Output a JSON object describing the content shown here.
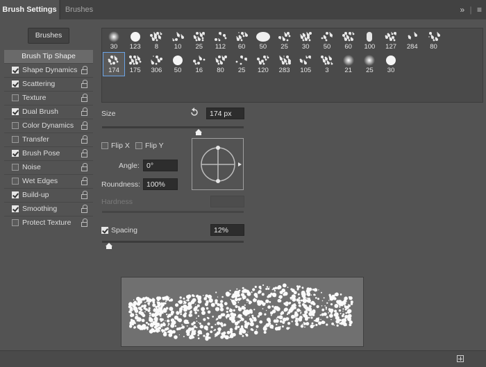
{
  "tabs": {
    "active": "Brush Settings",
    "inactive": "Brushes",
    "expand_icon": "double-chevron-right-icon",
    "menu_icon": "hamburger-menu-icon"
  },
  "brushes_button": "Brushes",
  "sidebar": {
    "items": [
      {
        "label": "Brush Tip Shape",
        "checkbox": null,
        "lock": false
      },
      {
        "label": "Shape Dynamics",
        "checkbox": true,
        "lock": true
      },
      {
        "label": "Scattering",
        "checkbox": true,
        "lock": true
      },
      {
        "label": "Texture",
        "checkbox": false,
        "lock": true
      },
      {
        "label": "Dual Brush",
        "checkbox": true,
        "lock": true
      },
      {
        "label": "Color Dynamics",
        "checkbox": false,
        "lock": true
      },
      {
        "label": "Transfer",
        "checkbox": false,
        "lock": true
      },
      {
        "label": "Brush Pose",
        "checkbox": true,
        "lock": true
      },
      {
        "label": "Noise",
        "checkbox": false,
        "lock": true
      },
      {
        "label": "Wet Edges",
        "checkbox": false,
        "lock": true
      },
      {
        "label": "Build-up",
        "checkbox": true,
        "lock": true
      },
      {
        "label": "Smoothing",
        "checkbox": true,
        "lock": true
      },
      {
        "label": "Protect Texture",
        "checkbox": false,
        "lock": true
      }
    ]
  },
  "brush_tips": {
    "row1": [
      "30",
      "123",
      "8",
      "10",
      "25",
      "112",
      "60",
      "50",
      "25",
      "30",
      "50",
      "60",
      "100",
      "127",
      "284",
      "80"
    ],
    "row2": [
      "174",
      "175",
      "306",
      "50",
      "16",
      "80",
      "25",
      "120",
      "283",
      "105",
      "3",
      "21",
      "25",
      "30"
    ],
    "selected": "174"
  },
  "size": {
    "label": "Size",
    "value": "174 px",
    "slider_fraction": 0.68,
    "reset_icon": "reset-arrow-icon"
  },
  "flip": {
    "x_label": "Flip X",
    "y_label": "Flip Y",
    "x_checked": false,
    "y_checked": false
  },
  "angle": {
    "label": "Angle:",
    "value": "0°"
  },
  "roundness": {
    "label": "Roundness:",
    "value": "100%"
  },
  "hardness": {
    "label": "Hardness",
    "value": ""
  },
  "spacing": {
    "label": "Spacing",
    "value": "12%",
    "checked": true,
    "slider_fraction": 0.05
  },
  "colors": {
    "panel": "#535353",
    "tabbar": "#424242",
    "selection": "#6ba4e6",
    "field": "#2d2d2d",
    "preview_bg": "#707070"
  },
  "bottom": {
    "new_icon": "create-new-preset-icon"
  }
}
